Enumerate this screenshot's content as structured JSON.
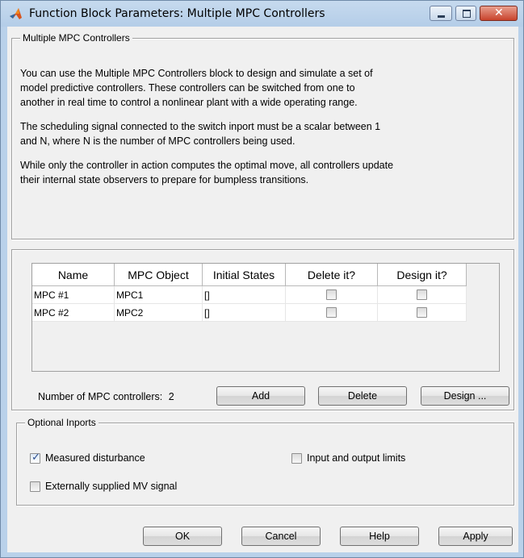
{
  "window": {
    "title": "Function Block Parameters: Multiple MPC Controllers"
  },
  "description_group": {
    "title": "Multiple MPC Controllers",
    "paragraphs": [
      "You can use the Multiple MPC Controllers block to design and simulate a set of model predictive controllers. These controllers can be switched from one to another in real time to control a nonlinear plant with a wide operating range.",
      "The scheduling signal connected to the switch inport must be a scalar between 1 and N, where N is the number of MPC controllers being used.",
      "While only the controller in action computes the optimal move, all controllers update their internal state observers to prepare for bumpless transitions."
    ],
    "para_lines": [
      [
        "You can use the Multiple MPC Controllers block to design and simulate a set of",
        "model predictive controllers. These controllers can be switched from one to",
        "another in real time to control a nonlinear plant with a wide operating range."
      ],
      [
        "The scheduling signal connected to the switch inport must be a scalar between 1",
        "and N, where N is the number of MPC controllers being used."
      ],
      [
        "While only the controller in action computes the optimal move, all controllers update",
        "their internal state observers to prepare for bumpless transitions."
      ]
    ]
  },
  "controllers_table": {
    "headers": [
      "Name",
      "MPC Object",
      "Initial States",
      "Delete it?",
      "Design it?"
    ],
    "rows": [
      {
        "name": "MPC #1",
        "object": "MPC1",
        "initial_states": "[]",
        "delete": false,
        "design": false
      },
      {
        "name": "MPC #2",
        "object": "MPC2",
        "initial_states": "[]",
        "delete": false,
        "design": false
      }
    ],
    "count_label": "Number of MPC controllers:",
    "count_value": "2",
    "buttons": {
      "add": "Add",
      "delete": "Delete",
      "design": "Design ..."
    }
  },
  "optional_inports": {
    "title": "Optional Inports",
    "measured_disturbance": {
      "label": "Measured disturbance",
      "checked": true
    },
    "io_limits": {
      "label": "Input and output limits",
      "checked": false
    },
    "external_mv": {
      "label": "Externally supplied MV signal",
      "checked": false
    }
  },
  "dialog_buttons": {
    "ok": "OK",
    "cancel": "Cancel",
    "help": "Help",
    "apply": "Apply"
  }
}
